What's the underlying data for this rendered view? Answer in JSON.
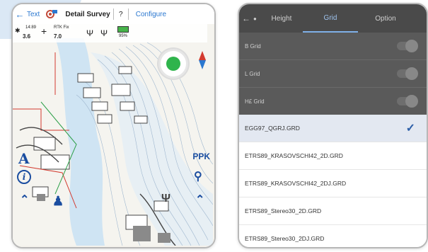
{
  "left_phone": {
    "toolbar": {
      "back_icon": "back-arrow-icon",
      "text_label": "Text",
      "settings_icon": "gear-icon",
      "title": "Detail Survey",
      "help_label": "?",
      "configure_label": "Configure"
    },
    "status": {
      "a_small": "14:89",
      "a_big": "3.6",
      "b_small": "RTK Fix",
      "b_big": "7.0",
      "battery": "95%"
    },
    "side_buttons": {
      "ppk_label": "PPK"
    },
    "compass_icon": "compass-icon"
  },
  "right_phone": {
    "header": {
      "back_icon": "back-arrow-icon",
      "tab_height_label": "Height",
      "tab_grid_label": "Grid",
      "tab_option_label": "Option"
    },
    "dim_rows": [
      {
        "label": "B Grid"
      },
      {
        "label": "L Grid"
      },
      {
        "label": "H£ Grid"
      }
    ],
    "grid_files": [
      {
        "label": "EGG97_QGRJ.GRD",
        "selected": true
      },
      {
        "label": "ETRS89_KRASOVSCHI42_2D.GRD",
        "selected": false
      },
      {
        "label": "ETRS89_KRASOVSCHI42_2DJ.GRD",
        "selected": false
      },
      {
        "label": "ETRS89_Stereo30_2D.GRD",
        "selected": false
      },
      {
        "label": "ETRS89_Stereo30_2DJ.GRD",
        "selected": false
      }
    ]
  },
  "colors": {
    "accent_blue": "#2b78d0",
    "gps_green": "#2fb44c",
    "header_dark": "#4a4a4a",
    "check_blue": "#2d5fa8"
  }
}
